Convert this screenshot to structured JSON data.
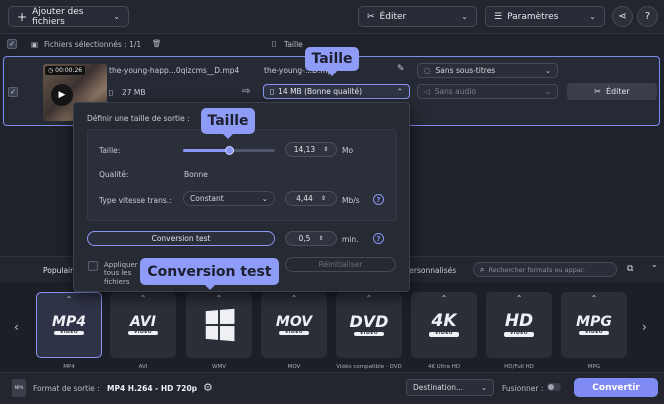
{
  "toolbar": {
    "add_files": "Ajouter des fichiers",
    "edit": "Éditer",
    "settings": "Paramètres",
    "help": "?"
  },
  "selection": {
    "label": "Fichiers sélectionnés : 1/1",
    "size_header": "Taille"
  },
  "file": {
    "duration": "00:00:26",
    "source_name": "the-young-happ...0qizcms__D.mp4",
    "source_size": "27 MB",
    "output_name": "the-young-...D.mp4",
    "output_quality": "14 MB (Bonne qualité)",
    "subtitles": "Sans sous-titres",
    "audio": "Sans audio",
    "edit_button": "Éditer"
  },
  "popup": {
    "title": "Définir une taille de sortie :",
    "size_label": "Taille:",
    "size_value": "14,13",
    "size_unit": "Mo",
    "size_slider_fraction": 0.5,
    "quality_label": "Qualité:",
    "quality_value": "Bonne",
    "bitrate_type_label": "Type vitesse trans.:",
    "bitrate_type_value": "Constant",
    "bitrate_value": "4,44",
    "bitrate_unit": "Mb/s",
    "test_button": "Conversion test",
    "test_duration": "0,5",
    "test_unit": "min.",
    "apply_all": "Appliquer à tous les fichiers",
    "reset_button": "Réinitialiser"
  },
  "tooltips": {
    "size_top": "Taille",
    "size_popup": "Taille",
    "test": "Conversion test"
  },
  "tabs": {
    "popular": "Populair",
    "custom": "Personnalisés",
    "search_placeholder": "Rechercher formats ou appar."
  },
  "formats": [
    {
      "logo": "MP4",
      "sub": "VIDEO",
      "label": "MP4"
    },
    {
      "logo": "AVI",
      "sub": "VIDEO",
      "label": "AVI"
    },
    {
      "logo": "",
      "sub": "",
      "label": "WMV"
    },
    {
      "logo": "MOV",
      "sub": "VIDEO",
      "label": "MOV"
    },
    {
      "logo": "DVD",
      "sub": "VIDEO",
      "label": "Vidéo compatible - DVD"
    },
    {
      "logo": "4K",
      "sub": "VIDEO",
      "label": "4K Ultra HD"
    },
    {
      "logo": "HD",
      "sub": "VIDEO",
      "label": "HD/Full HD"
    },
    {
      "logo": "MPG",
      "sub": "VIDEO",
      "label": "MPG"
    }
  ],
  "bottom": {
    "output_label": "Format de sortie :",
    "output_value": "MP4 H.264 - HD 720p",
    "destination": "Destination...",
    "merge": "Fusionner :",
    "convert": "Convertir"
  },
  "colors": {
    "accent": "#8a95f5",
    "tooltip": "#8f9cf7"
  }
}
